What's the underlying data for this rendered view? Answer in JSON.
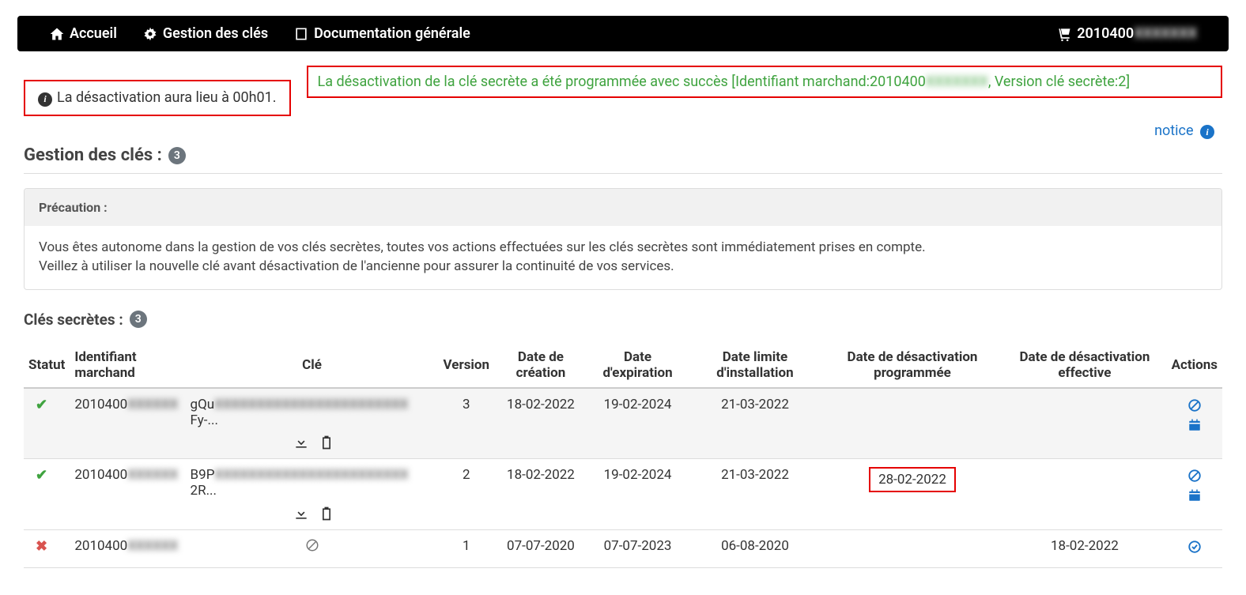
{
  "nav": {
    "home": "Accueil",
    "keys": "Gestion des clés",
    "docs": "Documentation générale",
    "merchant_prefix": "2010400",
    "merchant_blur": "XXXXXXX"
  },
  "alerts": {
    "info": "La désactivation aura lieu à 00h01.",
    "success_prefix": "La désactivation de la clé secrète a été programmée avec succès [Identifiant marchand:2010400",
    "success_blur": "XXXXXXX",
    "success_suffix": ", Version clé secrète:2]"
  },
  "notice": "notice",
  "section": {
    "title": "Gestion des clés :",
    "count": "3"
  },
  "panel": {
    "header": "Précaution :",
    "line1": "Vous êtes autonome dans la gestion de vos clés secrètes, toutes vos actions effectuées sur les clés secrètes sont immédiatement prises en compte.",
    "line2": "Veillez à utiliser la nouvelle clé avant désactivation de l'ancienne pour assurer la continuité de vos services."
  },
  "subtitle": {
    "label": "Clés secrètes :",
    "count": "3"
  },
  "headers": {
    "status": "Statut",
    "merchant": "Identifiant marchand",
    "key": "Clé",
    "version": "Version",
    "created": "Date de création",
    "expires": "Date d'expiration",
    "install_limit": "Date limite d'installation",
    "deact_sched": "Date de désactivation programmée",
    "deact_eff": "Date de désactivation effective",
    "actions": "Actions"
  },
  "rows": [
    {
      "status": "ok",
      "merchant_prefix": "2010400",
      "merchant_blur": "XXXXXX",
      "key_prefix": "gQu",
      "key_blur": "XXXXXXXXXXXXXXXXXXXXXXX",
      "key_suffix": "Fy-...",
      "version": "3",
      "created": "18-02-2022",
      "expires": "19-02-2024",
      "install_limit": "21-03-2022",
      "deact_sched": "",
      "deact_eff": "",
      "actions": "forbid_cal",
      "downloadable": true
    },
    {
      "status": "ok",
      "merchant_prefix": "2010400",
      "merchant_blur": "XXXXXX",
      "key_prefix": "B9P",
      "key_blur": "XXXXXXXXXXXXXXXXXXXXXXX",
      "key_suffix": "2R...",
      "version": "2",
      "created": "18-02-2022",
      "expires": "19-02-2024",
      "install_limit": "21-03-2022",
      "deact_sched": "28-02-2022",
      "deact_eff": "",
      "actions": "forbid_cal",
      "downloadable": true,
      "highlight_deact": true
    },
    {
      "status": "ko",
      "merchant_prefix": "2010400",
      "merchant_blur": "XXXXXX",
      "key_prefix": "",
      "key_blur": "",
      "key_suffix": "",
      "key_forbid": true,
      "version": "1",
      "created": "07-07-2020",
      "expires": "07-07-2023",
      "install_limit": "06-08-2020",
      "deact_sched": "",
      "deact_eff": "18-02-2022",
      "actions": "check_circle"
    }
  ]
}
